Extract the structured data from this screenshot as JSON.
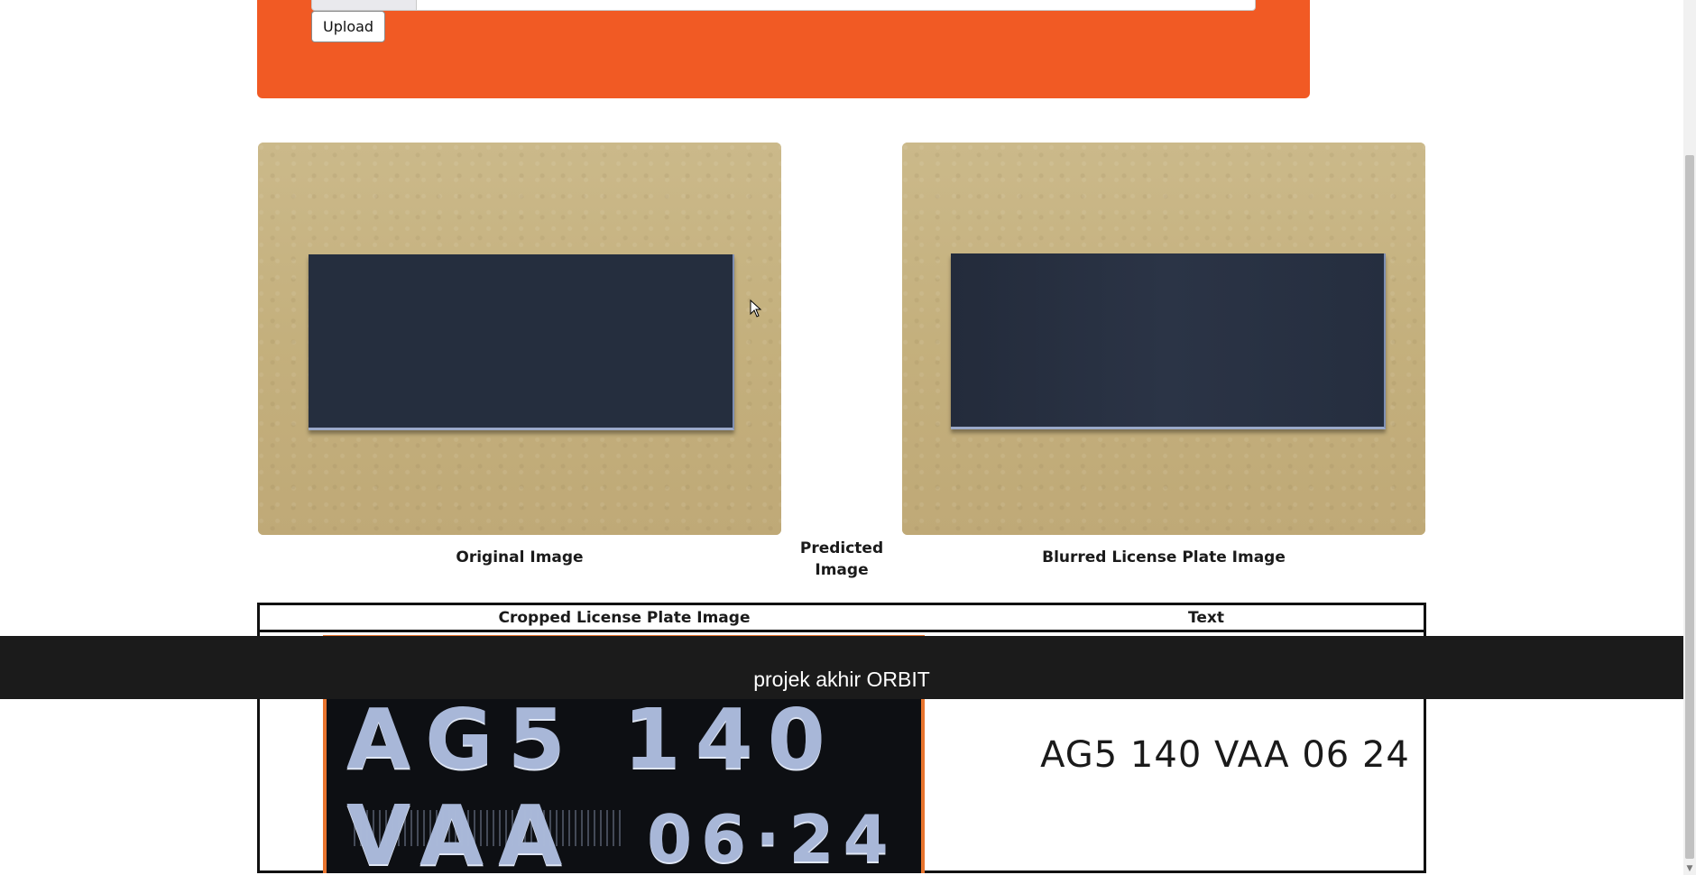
{
  "upload": {
    "button_label": "Upload",
    "accent_color": "#f15a24"
  },
  "images": {
    "original_caption": "Original Image",
    "predicted_caption": "Predicted Image",
    "blurred_caption": "Blurred License Plate Image"
  },
  "table": {
    "headers": [
      "Cropped License Plate Image",
      "Text"
    ],
    "plate_main": "AG5 140 VAA",
    "plate_date": "06·24",
    "recognized_text": "AG5 140 VAA 06 24"
  },
  "footer": {
    "text": "projek akhir ORBIT"
  },
  "icons": {
    "cursor": "mouse-pointer-icon",
    "scroll_down": "scroll-down-arrow-icon"
  }
}
